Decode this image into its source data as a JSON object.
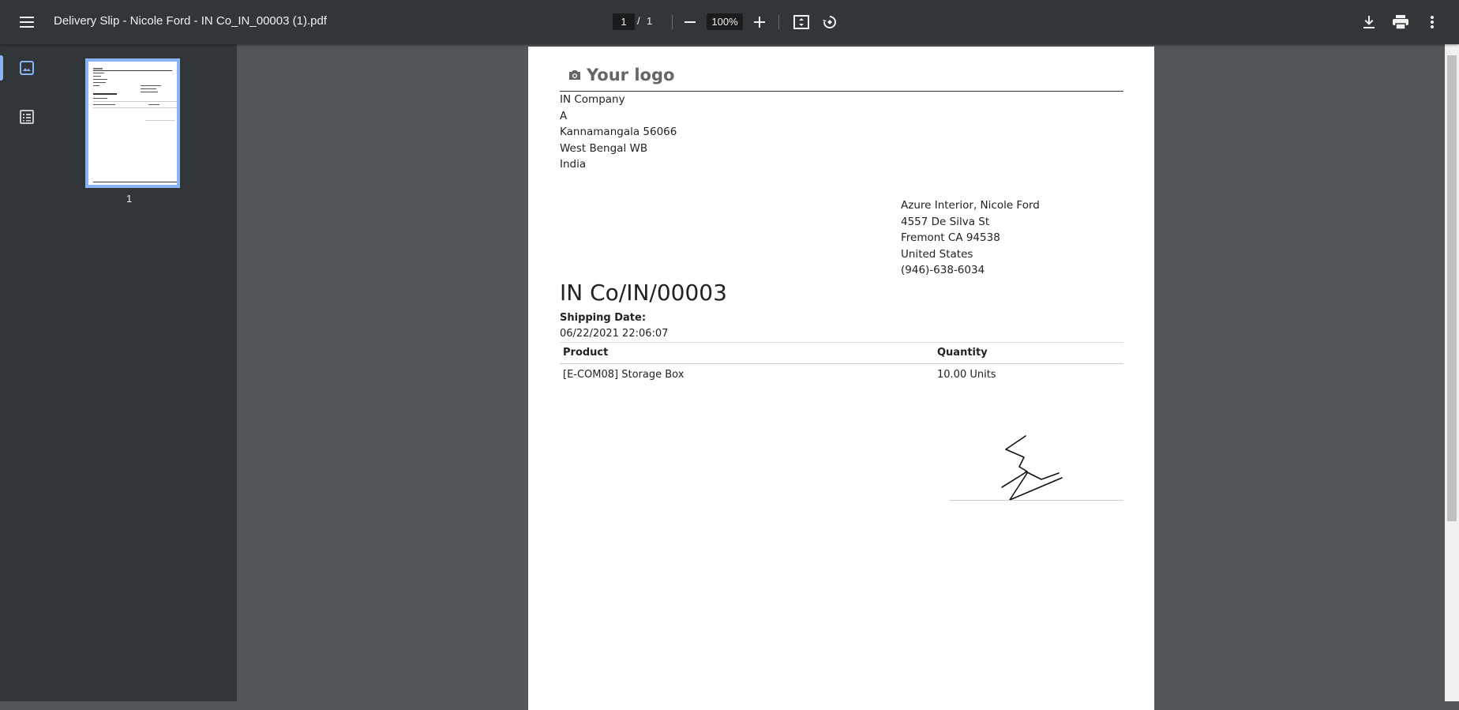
{
  "toolbar": {
    "title": "Delivery Slip - Nicole Ford - IN Co_IN_00003 (1).pdf",
    "current_page": "1",
    "page_separator": "/",
    "total_pages": "1",
    "zoom": "100%"
  },
  "sidebar": {
    "thumbnail_page_number": "1"
  },
  "document": {
    "logo_text": "Your logo",
    "company_address": [
      "IN Company",
      "A",
      "Kannamangala 56066",
      "West Bengal WB",
      "India"
    ],
    "customer_address": [
      "Azure Interior, Nicole Ford",
      "4557 De Silva St",
      "Fremont CA 94538",
      "United States",
      "(946)-638-6034"
    ],
    "doc_number": "IN Co/IN/00003",
    "shipping_label": "Shipping Date:",
    "shipping_date": "06/22/2021 22:06:07",
    "table": {
      "headers": [
        "Product",
        "Quantity"
      ],
      "rows": [
        [
          "[E-COM08] Storage Box",
          "10.00 Units"
        ]
      ]
    }
  }
}
